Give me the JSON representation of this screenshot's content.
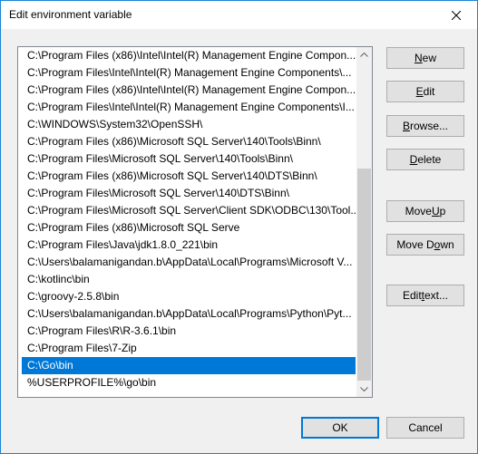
{
  "window": {
    "title": "Edit environment variable"
  },
  "list": {
    "items": [
      "C:\\Program Files (x86)\\Intel\\Intel(R) Management Engine Compon...",
      "C:\\Program Files\\Intel\\Intel(R) Management Engine Components\\...",
      "C:\\Program Files (x86)\\Intel\\Intel(R) Management Engine Compon...",
      "C:\\Program Files\\Intel\\Intel(R) Management Engine Components\\I...",
      "C:\\WINDOWS\\System32\\OpenSSH\\",
      "C:\\Program Files (x86)\\Microsoft SQL Server\\140\\Tools\\Binn\\",
      "C:\\Program Files\\Microsoft SQL Server\\140\\Tools\\Binn\\",
      "C:\\Program Files (x86)\\Microsoft SQL Server\\140\\DTS\\Binn\\",
      "C:\\Program Files\\Microsoft SQL Server\\140\\DTS\\Binn\\",
      "C:\\Program Files\\Microsoft SQL Server\\Client SDK\\ODBC\\130\\Tool...",
      "C:\\Program Files (x86)\\Microsoft SQL Serve",
      "C:\\Program Files\\Java\\jdk1.8.0_221\\bin",
      "C:\\Users\\balamanigandan.b\\AppData\\Local\\Programs\\Microsoft V...",
      "C:\\kotlinc\\bin",
      "C:\\groovy-2.5.8\\bin",
      "C:\\Users\\balamanigandan.b\\AppData\\Local\\Programs\\Python\\Pyt...",
      "C:\\Program Files\\R\\R-3.6.1\\bin",
      "C:\\Program Files\\7-Zip",
      "C:\\Go\\bin",
      "%USERPROFILE%\\go\\bin"
    ],
    "selected_index": 18
  },
  "buttons": {
    "new": {
      "pre": "",
      "acc": "N",
      "post": "ew"
    },
    "edit": {
      "pre": "",
      "acc": "E",
      "post": "dit"
    },
    "browse": {
      "pre": "",
      "acc": "B",
      "post": "rowse..."
    },
    "delete": {
      "pre": "",
      "acc": "D",
      "post": "elete"
    },
    "move_up": {
      "pre": "Move ",
      "acc": "U",
      "post": "p"
    },
    "move_down": {
      "pre": "Move D",
      "acc": "o",
      "post": "wn"
    },
    "edit_text": {
      "pre": "Edit ",
      "acc": "t",
      "post": "ext..."
    },
    "ok": "OK",
    "cancel": "Cancel"
  },
  "icons": {
    "close": "close-icon",
    "scroll_up": "chevron-up-icon",
    "scroll_down": "chevron-down-icon"
  },
  "colors": {
    "selection": "#0078d7",
    "window_border": "#1883d7"
  }
}
